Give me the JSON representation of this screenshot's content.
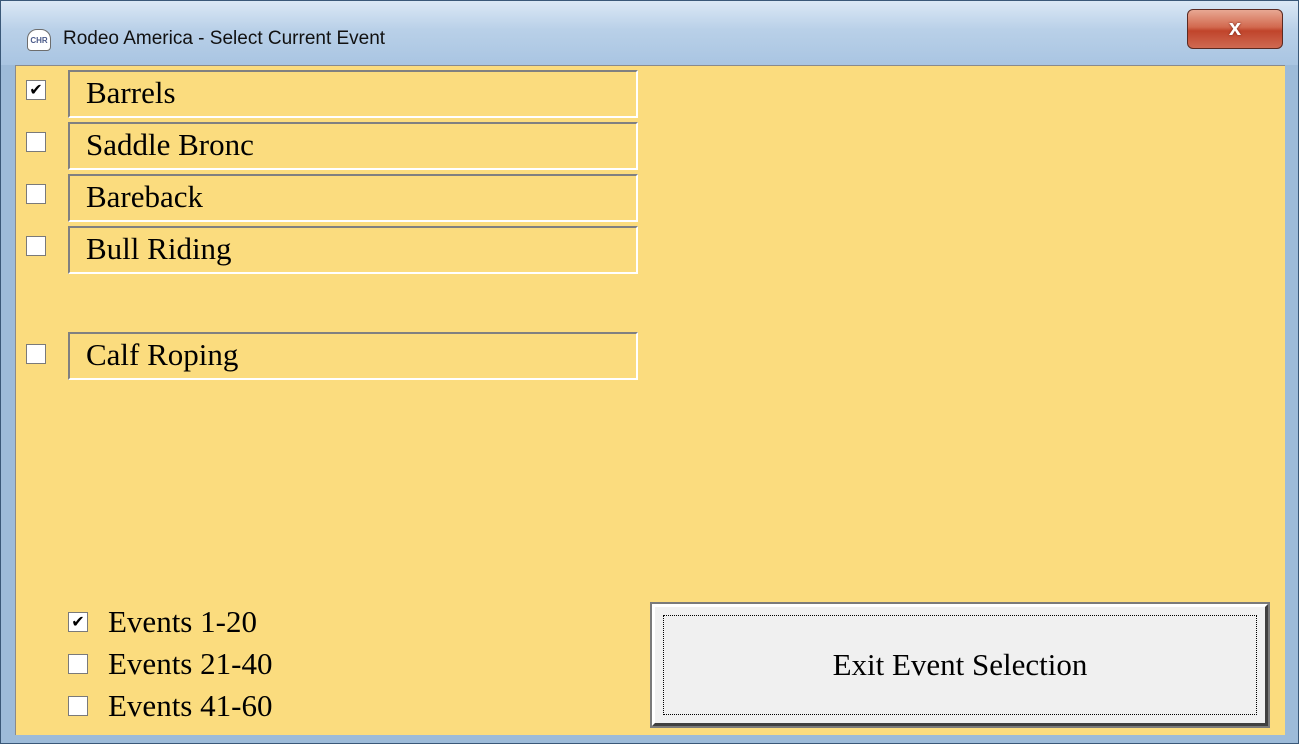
{
  "window": {
    "title": "Rodeo America - Select Current Event",
    "icon_text": "CHR",
    "close_label": "x"
  },
  "events": [
    {
      "label": "Barrels",
      "checked": true
    },
    {
      "label": "Saddle Bronc",
      "checked": false
    },
    {
      "label": "Bareback",
      "checked": false
    },
    {
      "label": "Bull Riding",
      "checked": false
    },
    {
      "label": "Calf Roping",
      "checked": false
    }
  ],
  "ranges": [
    {
      "label": "Events 1-20",
      "checked": true
    },
    {
      "label": "Events 21-40",
      "checked": false
    },
    {
      "label": "Events 41-60",
      "checked": false
    }
  ],
  "exit_button": {
    "label": "Exit Event Selection"
  },
  "check_glyph": "✔",
  "colors": {
    "client_bg": "#fbdc7e",
    "titlebar": "#b9d0e8",
    "close": "#c0442b"
  }
}
